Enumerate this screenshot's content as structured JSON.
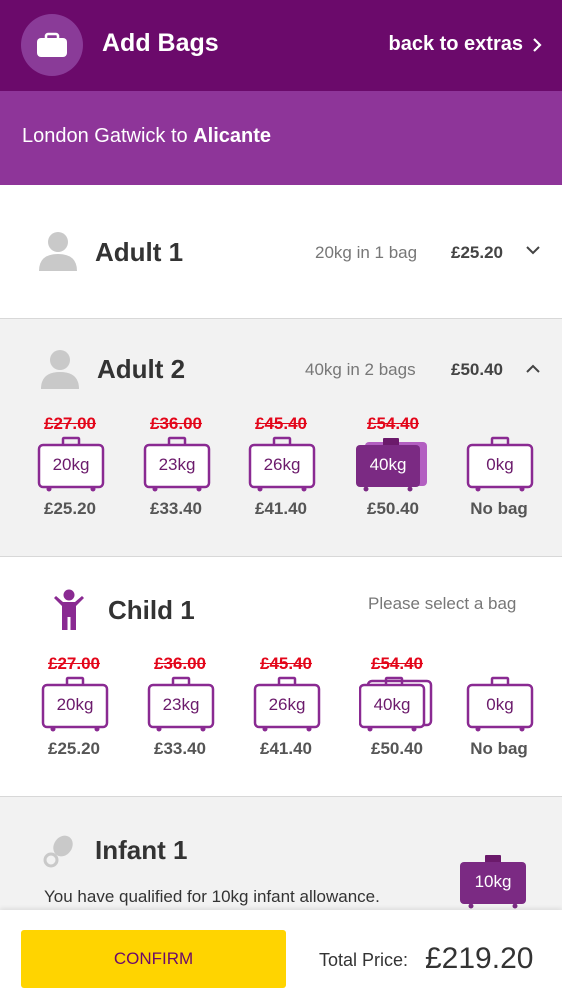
{
  "header": {
    "title": "Add Bags",
    "back_label": "back to extras",
    "icon": "suitcase-icon"
  },
  "route": {
    "prefix": "London Gatwick to ",
    "destination": "Alicante"
  },
  "colors": {
    "header_bg": "#6b0a6b",
    "route_bg": "#8e3599",
    "accent_purple": "#8a2a92",
    "strike_red": "#e3061a",
    "confirm_yellow": "#ffd400"
  },
  "passengers": [
    {
      "name": "Adult 1",
      "summary": "20kg in 1 bag",
      "price": "£25.20",
      "expanded": false
    },
    {
      "name": "Adult 2",
      "summary": "40kg in 2 bags",
      "price": "£50.40",
      "expanded": true,
      "options": [
        {
          "was": "£27.00",
          "weight": "20kg",
          "price": "£25.20",
          "selected": false
        },
        {
          "was": "£36.00",
          "weight": "23kg",
          "price": "£33.40",
          "selected": false
        },
        {
          "was": "£45.40",
          "weight": "26kg",
          "price": "£41.40",
          "selected": false
        },
        {
          "was": "£54.40",
          "weight": "40kg",
          "price": "£50.40",
          "selected": true
        },
        {
          "was": "",
          "weight": "0kg",
          "price": "No bag",
          "selected": false
        }
      ]
    },
    {
      "name": "Child 1",
      "summary": "Please select a bag",
      "options": [
        {
          "was": "£27.00",
          "weight": "20kg",
          "price": "£25.20",
          "selected": false
        },
        {
          "was": "£36.00",
          "weight": "23kg",
          "price": "£33.40",
          "selected": false
        },
        {
          "was": "£45.40",
          "weight": "26kg",
          "price": "£41.40",
          "selected": false
        },
        {
          "was": "£54.40",
          "weight": "40kg",
          "price": "£50.40",
          "selected": false
        },
        {
          "was": "",
          "weight": "0kg",
          "price": "No bag",
          "selected": false
        }
      ]
    },
    {
      "name": "Infant 1",
      "text": "You have qualified for 10kg infant allowance.",
      "allowance": "10kg"
    }
  ],
  "footer": {
    "confirm_label": "CONFIRM",
    "total_label": "Total Price:",
    "total_value": "£219.20"
  }
}
